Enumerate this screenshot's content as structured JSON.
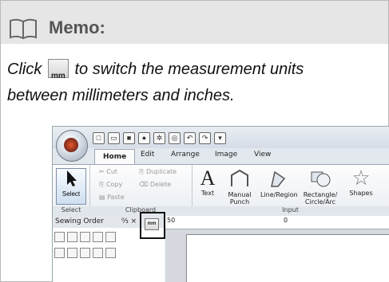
{
  "memo": {
    "title": "Memo:",
    "line1_before": "Click",
    "line1_icon_text": "mm",
    "line1_after": "to switch the measurement units",
    "line2": "between millimeters and inches."
  },
  "app": {
    "tabs": [
      "Home",
      "Edit",
      "Arrange",
      "Image",
      "View"
    ],
    "clipboard": {
      "cut": "Cut",
      "copy": "Copy",
      "paste": "Paste",
      "duplicate": "Duplicate",
      "delete": "Delete"
    },
    "groups": {
      "select": "Select",
      "clipboard": "Clipboard",
      "input": "Input"
    },
    "buttons": {
      "select": "Select",
      "text": "Text",
      "manual_punch": "Manual Punch",
      "line_region": "Line/Region",
      "rect_circle": "Rectangle/ Circle/Arc",
      "shapes": "Shapes"
    },
    "panel_title": "Sewing Order",
    "panel_controls": "↉ ×",
    "units_button": "mm",
    "ruler_left": "50",
    "ruler_right": "0"
  }
}
